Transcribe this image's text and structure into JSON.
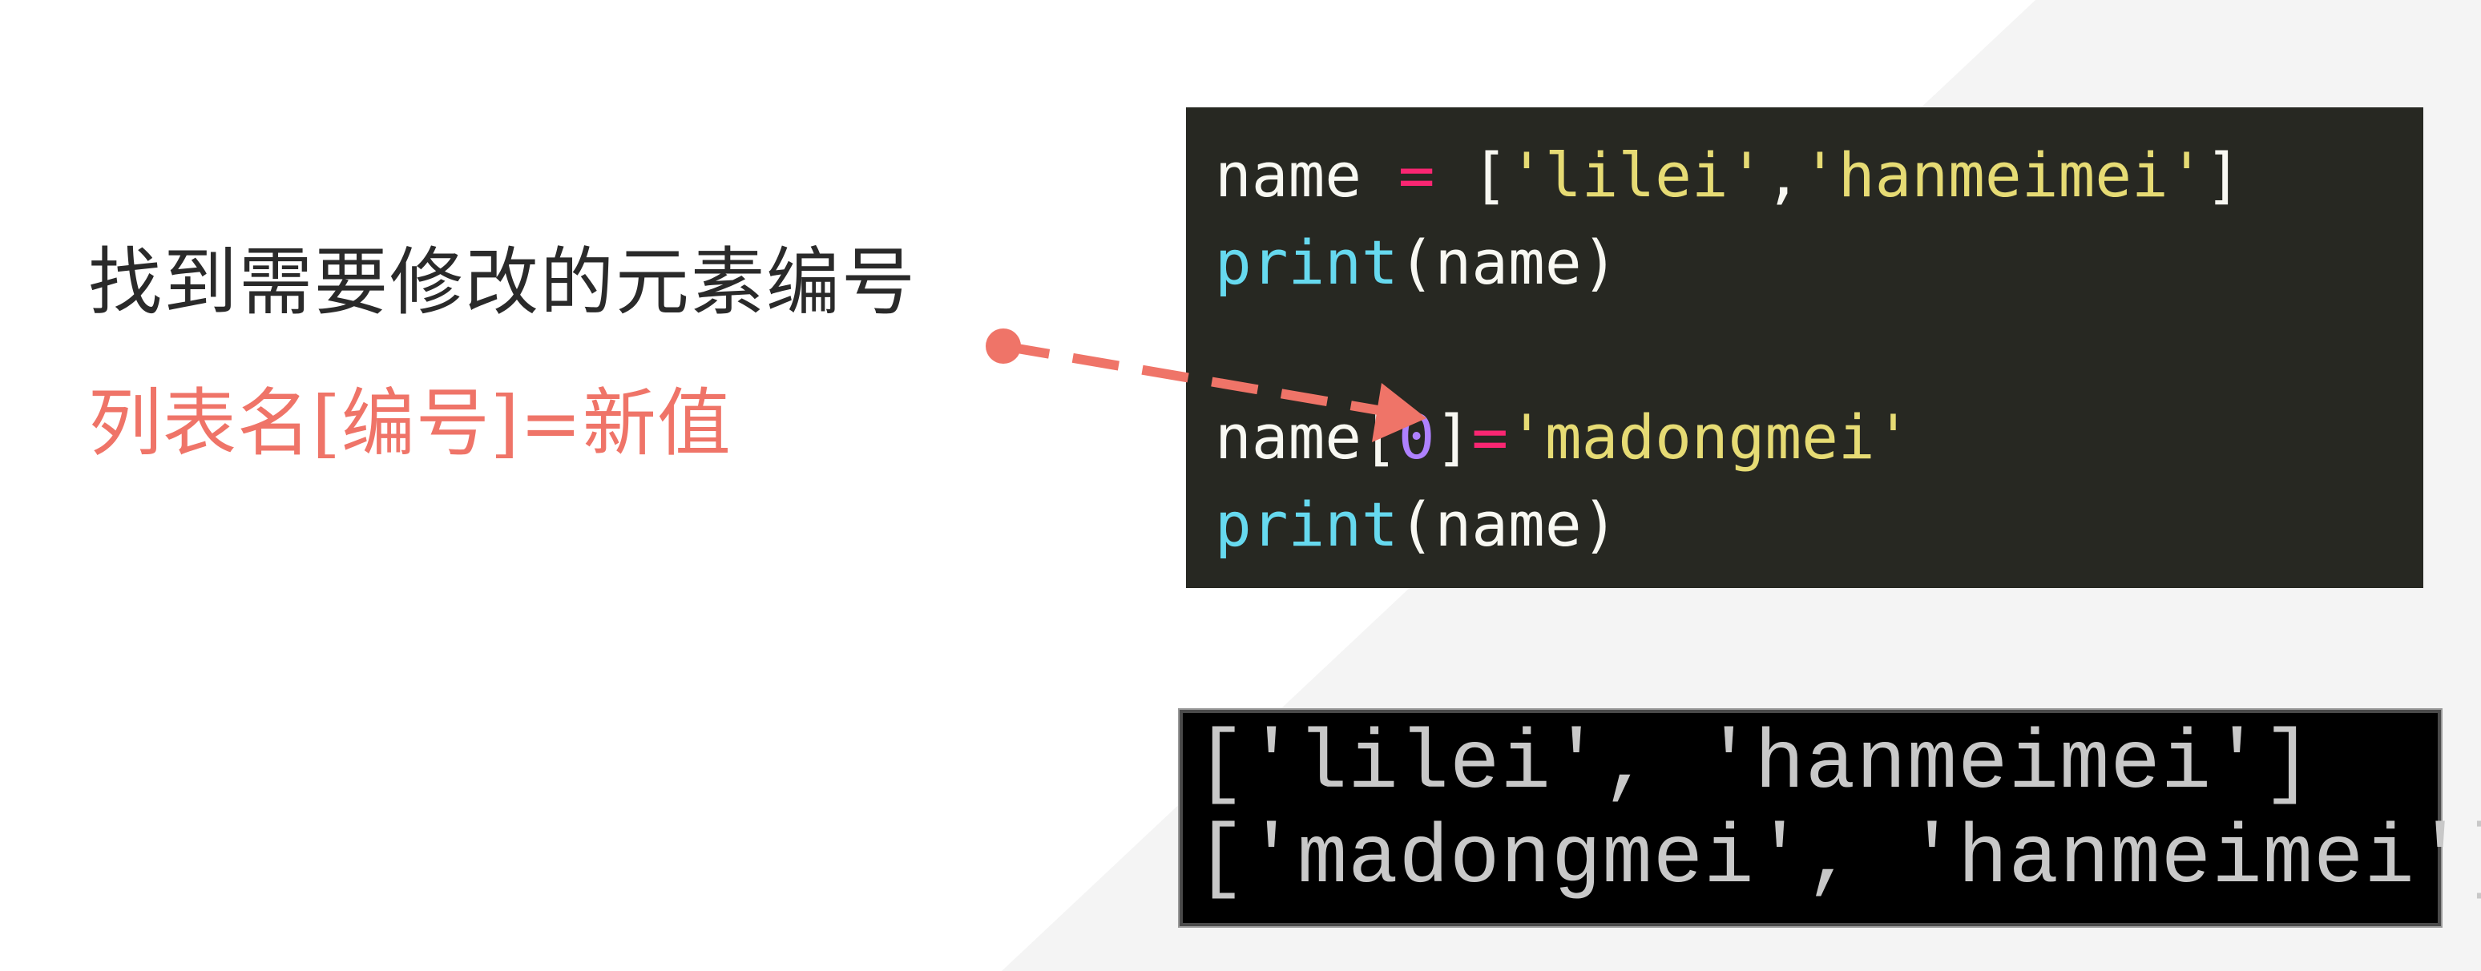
{
  "slide": {
    "instruction": "找到需要修改的元素编号",
    "syntax": "列表名[编号]=新值"
  },
  "code_panel": {
    "line1": {
      "ident": "name",
      "op": "=",
      "open": "[",
      "str1": "'lilei'",
      "comma": ",",
      "str2": "'hanmeimei'",
      "close": "]"
    },
    "line2": {
      "fn": "print",
      "open": "(",
      "arg": "name",
      "close": ")"
    },
    "line4": {
      "ident": "name",
      "open": "[",
      "index": "0",
      "close": "]",
      "op": "=",
      "str": "'madongmei'"
    },
    "line5": {
      "fn": "print",
      "open": "(",
      "arg": "name",
      "close": ")"
    }
  },
  "console": {
    "lines": [
      "['lilei', 'hanmeimei']",
      "['madongmei', 'hanmeimei']"
    ]
  },
  "colors": {
    "accent": "#ef7468",
    "code_bg": "#272822",
    "console_bg": "#000000"
  },
  "icons": {
    "pointer": "dashed-arrow-icon"
  }
}
